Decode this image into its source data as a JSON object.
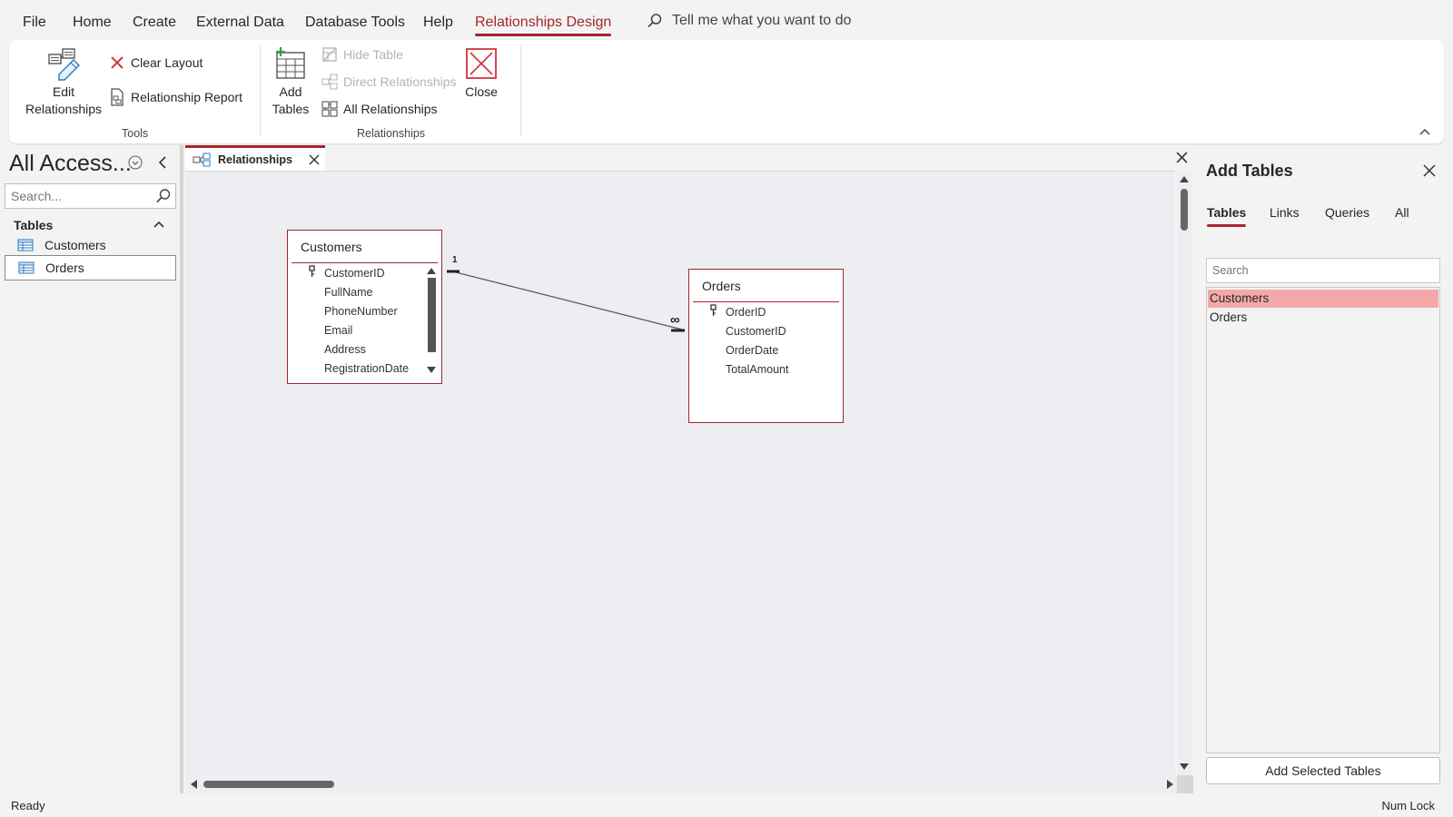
{
  "menu": {
    "items": [
      "File",
      "Home",
      "Create",
      "External Data",
      "Database Tools",
      "Help",
      "Relationships Design"
    ],
    "active": "Relationships Design",
    "tell_me": "Tell me what you want to do"
  },
  "ribbon": {
    "tools": {
      "edit_relationships_line1": "Edit",
      "edit_relationships_line2": "Relationships",
      "clear_layout": "Clear Layout",
      "relationship_report": "Relationship Report",
      "group_label": "Tools"
    },
    "relationships": {
      "add_tables_line1": "Add",
      "add_tables_line2": "Tables",
      "hide_table": "Hide Table",
      "direct_relationships": "Direct Relationships",
      "all_relationships": "All Relationships",
      "close": "Close",
      "group_label": "Relationships"
    }
  },
  "nav": {
    "title": "All Access...",
    "search_placeholder": "Search...",
    "group": "Tables",
    "items": [
      "Customers",
      "Orders"
    ],
    "selected": "Orders"
  },
  "document": {
    "tab_label": "Relationships",
    "tables": [
      {
        "name": "Customers",
        "fields": [
          "CustomerID",
          "FullName",
          "PhoneNumber",
          "Email",
          "Address",
          "RegistrationDate"
        ],
        "key_field": "CustomerID"
      },
      {
        "name": "Orders",
        "fields": [
          "OrderID",
          "CustomerID",
          "OrderDate",
          "TotalAmount"
        ],
        "key_field": "OrderID"
      }
    ],
    "relationship": {
      "one_label": "1",
      "many_label": "∞"
    }
  },
  "add_tables_pane": {
    "title": "Add Tables",
    "tabs": [
      "Tables",
      "Links",
      "Queries",
      "All"
    ],
    "active_tab": "Tables",
    "search_placeholder": "Search",
    "items": [
      "Customers",
      "Orders"
    ],
    "selected": "Customers",
    "button": "Add Selected Tables"
  },
  "status": {
    "left": "Ready",
    "right": "Num Lock"
  },
  "colors": {
    "accent": "#a4262c",
    "selection": "#f4a9a9"
  }
}
